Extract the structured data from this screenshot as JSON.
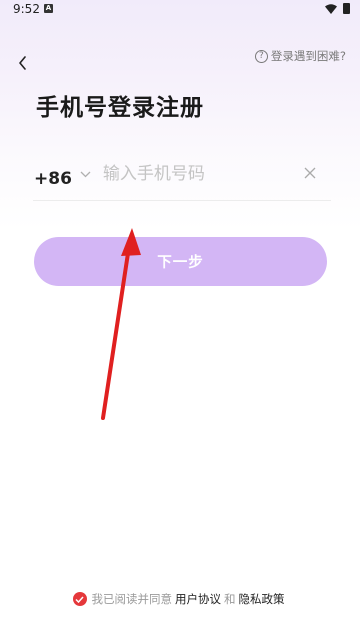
{
  "status_bar": {
    "time": "9:52",
    "notification_icon": "A"
  },
  "header": {
    "back_icon": "back-icon",
    "help_text": "登录遇到困难?"
  },
  "title": "手机号登录注册",
  "phone": {
    "country_code": "+86",
    "placeholder": "输入手机号码",
    "value": ""
  },
  "next_button": {
    "label": "下一步",
    "color": "#d3b6f5"
  },
  "agreement": {
    "prefix": "我已阅读并同意",
    "user_agreement": "用户协议",
    "and": "和",
    "privacy_policy": "隐私政策",
    "checked": true
  },
  "colors": {
    "accent": "#d3b6f5",
    "check_red": "#e5383b",
    "annotation_arrow": "#e02020"
  }
}
